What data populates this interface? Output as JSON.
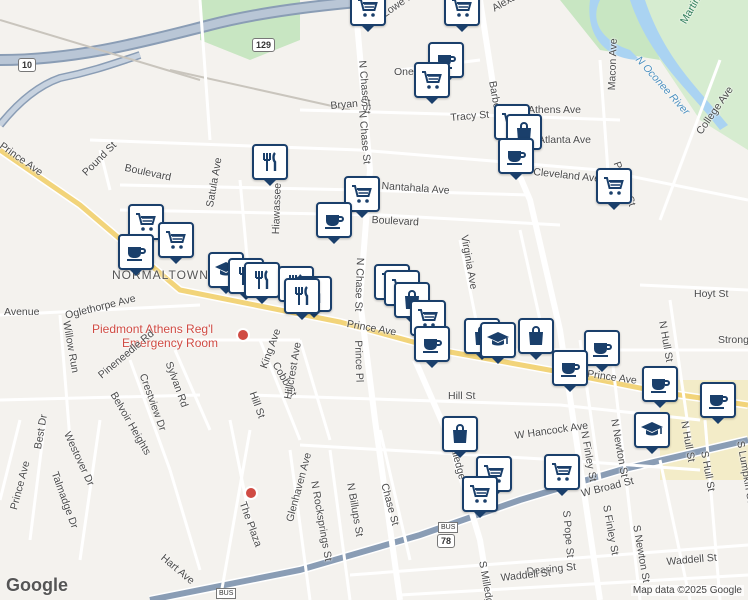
{
  "attribution": "Map data ©2025 Google",
  "logo": "Google",
  "colors": {
    "pin_border": "#1a3f6b",
    "pin_glyph": "#1a3f6b",
    "water": "#aad3f2",
    "park": "#c8e6c2",
    "highway": "#8a9db5",
    "poi_red": "#d04b43"
  },
  "route_shields": [
    {
      "text": "129",
      "kind": "shield"
    },
    {
      "text": "10",
      "kind": "shield"
    },
    {
      "text": "78",
      "kind": "shield"
    },
    {
      "text": "BUS",
      "kind": "bus"
    },
    {
      "text": "BUS",
      "kind": "bus"
    }
  ],
  "neighborhood": "NORMALTOWN",
  "poi": {
    "name_line1": "Piedmont Athens Reg'l",
    "name_line2": "Emergency Room"
  },
  "streets": [
    "Prince Ave",
    "Pound St",
    "Boulevard",
    "Satula Ave",
    "Hiawassee",
    "Oglethorpe Ave",
    "Willow Run",
    "Pineneedle Rd",
    "Crestview Dr",
    "Sylvan Rd",
    "Belvoir Heights",
    "Westover Dr",
    "Best Dr",
    "Talmadge Dr",
    "Hart Ave",
    "King Ave",
    "Cobb St",
    "Hill St",
    "Hillcrest Ave",
    "The Plaza",
    "Glenhaven Ave",
    "N Rocksprings St",
    "N Billups St",
    "N Chase St",
    "Prince Pl",
    "Bryan St",
    "Nantahala Ave",
    "Cleveland Ave",
    "Tracy St",
    "Barber St",
    "Macon Ave",
    "College Ave",
    "Pulaski St",
    "Hoyt St",
    "Virginia Ave",
    "N Hull St",
    "W Hancock Ave",
    "W Broad St",
    "Dearing St",
    "Waddell St",
    "S Finley St",
    "N Finley St",
    "S Newton St",
    "N Newton St",
    "S Pope St",
    "S Hull St",
    "S Lumpkin St",
    "S Milledge Ave",
    "N Oconee River",
    "Martin Luther King Jr Pkwy",
    "Strong",
    "Chase St",
    "Lowe Rd",
    "Alexander",
    "One",
    "Athens Ave",
    "Atlanta Ave",
    "Avenue",
    "Milledge"
  ],
  "markers": [
    {
      "icon": "cart-icon",
      "kind": "grocery"
    },
    {
      "icon": "cart-icon",
      "kind": "grocery"
    },
    {
      "icon": "cup-icon",
      "kind": "cafe"
    },
    {
      "icon": "cart-icon",
      "kind": "grocery"
    },
    {
      "icon": "cart-icon",
      "kind": "grocery"
    },
    {
      "icon": "bag-icon",
      "kind": "shopping"
    },
    {
      "icon": "cup-icon",
      "kind": "cafe"
    },
    {
      "icon": "cart-icon",
      "kind": "grocery"
    },
    {
      "icon": "fork-knife-icon",
      "kind": "restaurant"
    },
    {
      "icon": "cart-icon",
      "kind": "grocery"
    },
    {
      "icon": "cart-icon",
      "kind": "grocery"
    },
    {
      "icon": "cup-icon",
      "kind": "cafe"
    },
    {
      "icon": "cup-icon",
      "kind": "cafe"
    },
    {
      "icon": "graduation-cap-icon",
      "kind": "school"
    },
    {
      "icon": "fork-knife-icon",
      "kind": "restaurant"
    },
    {
      "icon": "fork-knife-icon",
      "kind": "restaurant"
    },
    {
      "icon": "fork-knife-icon",
      "kind": "restaurant"
    },
    {
      "icon": "fork-knife-icon",
      "kind": "restaurant"
    },
    {
      "icon": "fork-knife-icon",
      "kind": "restaurant"
    },
    {
      "icon": "cart-icon",
      "kind": "grocery"
    },
    {
      "icon": "cart-icon",
      "kind": "grocery"
    },
    {
      "icon": "bag-icon",
      "kind": "shopping"
    },
    {
      "icon": "cart-icon",
      "kind": "grocery"
    },
    {
      "icon": "cup-icon",
      "kind": "cafe"
    },
    {
      "icon": "bag-icon",
      "kind": "shopping"
    },
    {
      "icon": "graduation-cap-icon",
      "kind": "school"
    },
    {
      "icon": "bag-icon",
      "kind": "shopping"
    },
    {
      "icon": "cart-icon",
      "kind": "grocery"
    },
    {
      "icon": "cup-icon",
      "kind": "cafe"
    },
    {
      "icon": "cup-icon",
      "kind": "cafe"
    },
    {
      "icon": "cup-icon",
      "kind": "cafe"
    },
    {
      "icon": "cup-icon",
      "kind": "cafe"
    },
    {
      "icon": "graduation-cap-icon",
      "kind": "school"
    },
    {
      "icon": "bag-icon",
      "kind": "shopping"
    },
    {
      "icon": "cart-icon",
      "kind": "grocery"
    },
    {
      "icon": "cart-icon",
      "kind": "grocery"
    },
    {
      "icon": "cart-icon",
      "kind": "grocery"
    }
  ]
}
